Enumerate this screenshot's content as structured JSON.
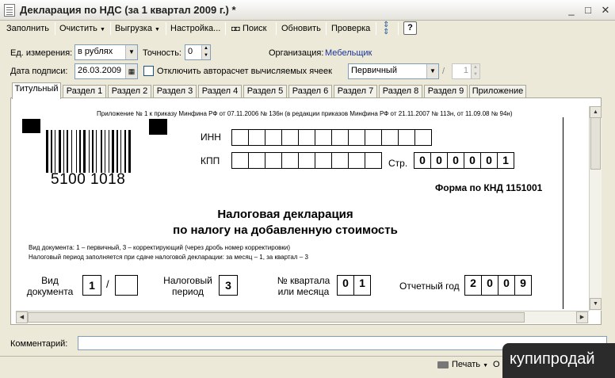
{
  "window": {
    "title": "Декларация по НДС (за 1 квартал 2009 г.) *",
    "minimize": "_",
    "maximize": "□",
    "close": "✕"
  },
  "toolbar": {
    "fill": "Заполнить",
    "clear": "Очистить",
    "export": "Выгрузка",
    "settings": "Настройка...",
    "search": "Поиск",
    "refresh": "Обновить",
    "check": "Проверка",
    "help": "?"
  },
  "fields": {
    "unit_label": "Ед. измерения:",
    "unit_value": "в рублях",
    "precision_label": "Точность:",
    "precision_value": "0",
    "org_label": "Организация:",
    "org_value": "Мебельщик",
    "date_label": "Дата подписи:",
    "date_value": "26.03.2009",
    "autocalc_label": "Отключить авторасчет вычисляемых ячеек",
    "type_value": "Первичный",
    "slash": "/",
    "correction_number": "1"
  },
  "tabs": [
    "Титульный",
    "Раздел 1",
    "Раздел 2",
    "Раздел 3",
    "Раздел 4",
    "Раздел 5",
    "Раздел 6",
    "Раздел 7",
    "Раздел 8",
    "Раздел 9",
    "Приложение"
  ],
  "form": {
    "appendix_note": "Приложение № 1 к приказу Минфина РФ от 07.11.2006 № 136н (в редакции приказов Минфина РФ от 21.11.2007 № 113н, от 11.09.08 № 94н)",
    "barcode_number": "5100 1018",
    "inn_label": "ИНН",
    "kpp_label": "КПП",
    "page_label": "Стр.",
    "page_digits": [
      "0",
      "0",
      "0",
      "0",
      "0",
      "1"
    ],
    "form_code": "Форма по КНД 1151001",
    "title_line1": "Налоговая декларация",
    "title_line2": "по налогу на добавленную стоимость",
    "note_line1": "Вид документа: 1 – первичный, 3 – корректирующий (через дробь номер корректировки)",
    "note_line2": "Налоговый период заполняется при сдаче налоговой декларации: за месяц – 1, за квартал – 3",
    "doc_type_label_1": "Вид",
    "doc_type_label_2": "документа",
    "doc_type_value": "1",
    "doc_slash": "/",
    "tax_period_label_1": "Налоговый",
    "tax_period_label_2": "период",
    "tax_period_value": "3",
    "quarter_label_1": "№ квартала",
    "quarter_label_2": "или месяца",
    "quarter_digits": [
      "0",
      "1"
    ],
    "year_label": "Отчетный год",
    "year_digits": [
      "2",
      "0",
      "0",
      "9"
    ]
  },
  "comment_label": "Комментарий:",
  "bottom": {
    "print": "Печать",
    "watermark": "купипродай"
  }
}
